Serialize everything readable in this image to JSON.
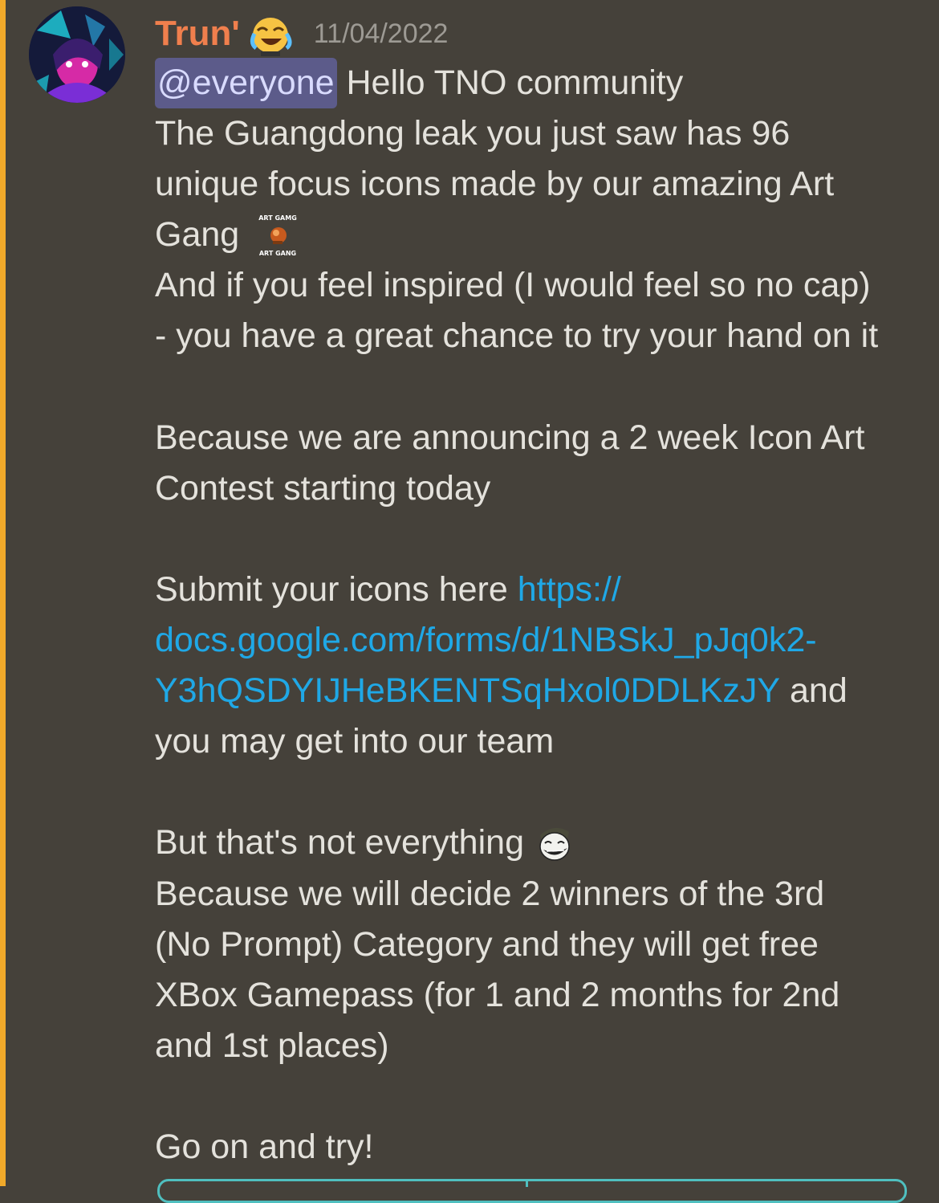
{
  "message": {
    "author": "Trun'",
    "role_icon": "crying-laughing-face-icon",
    "timestamp": "11/04/2022",
    "lines": [
      {
        "mention": "@everyone",
        "text": " Hello TNO community"
      },
      {
        "text": "The Guangdong leak you just saw has 96"
      },
      {
        "text": "unique focus icons made by our amazing Art"
      },
      {
        "text": "Gang ",
        "emoji": "art-gang-emoji-icon",
        "emoji_caption_top": "ART GAMG",
        "emoji_caption_bottom": "ART GANG"
      },
      {
        "text": "And if you feel inspired (I would feel so no cap)"
      },
      {
        "text": "- you have a great chance to try your hand on it"
      },
      {
        "text": ""
      },
      {
        "text": "Because we are announcing a 2 week Icon Art"
      },
      {
        "text": "Contest starting today"
      },
      {
        "text": ""
      },
      {
        "text": "Submit your icons here ",
        "link": "https://"
      },
      {
        "link": "docs.google.com/forms/d/1NBSkJ_pJq0k2-"
      },
      {
        "link": "Y3hQSDYIJHeBKENTSqHxol0DDLKzJY",
        "text_after": " and"
      },
      {
        "text": "you may get into our team"
      },
      {
        "text": ""
      },
      {
        "text": "But that's not everything ",
        "emoji": "trollface-emoji-icon"
      },
      {
        "text": "Because we will decide 2 winners of the 3rd"
      },
      {
        "text": "(No Prompt) Category and they will get free"
      },
      {
        "text": "XBox Gamepass (for 1 and 2 months for 2nd"
      },
      {
        "text": "and 1st places)"
      },
      {
        "text": ""
      },
      {
        "text": "Go on and try!"
      }
    ]
  },
  "colors": {
    "background": "#45413a",
    "mention_bar": "#f0a92a",
    "username": "#f07f4d",
    "link": "#1fa8e6",
    "mention_bg": "#5c5b8a"
  }
}
